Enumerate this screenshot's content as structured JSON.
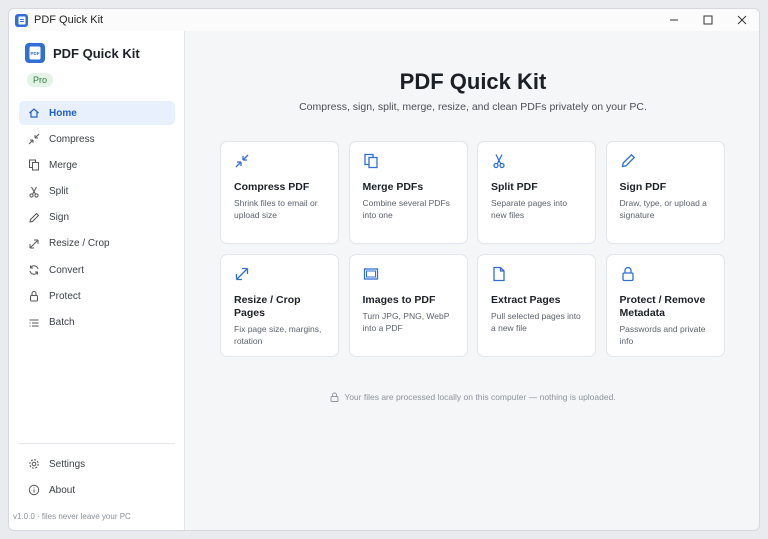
{
  "window": {
    "title": "PDF Quick Kit"
  },
  "sidebar": {
    "brand": "PDF Quick Kit",
    "badge": "Pro",
    "items": [
      {
        "label": "Home",
        "icon": "home-icon",
        "active": true
      },
      {
        "label": "Compress",
        "icon": "compress-icon"
      },
      {
        "label": "Merge",
        "icon": "merge-icon"
      },
      {
        "label": "Split",
        "icon": "scissors-icon"
      },
      {
        "label": "Sign",
        "icon": "pen-icon"
      },
      {
        "label": "Resize / Crop",
        "icon": "resize-icon"
      },
      {
        "label": "Convert",
        "icon": "convert-icon"
      },
      {
        "label": "Protect",
        "icon": "lock-icon"
      },
      {
        "label": "Batch",
        "icon": "list-icon"
      }
    ],
    "bottom_items": [
      {
        "label": "Settings",
        "icon": "gear-icon"
      },
      {
        "label": "About",
        "icon": "info-icon"
      }
    ],
    "version": "v1.0.0 · files never leave your PC"
  },
  "main": {
    "title": "PDF Quick Kit",
    "subtitle": "Compress, sign, split, merge, resize, and clean PDFs privately on your PC.",
    "cards": [
      {
        "title": "Compress PDF",
        "desc": "Shrink files to email or upload size",
        "icon": "compress-icon"
      },
      {
        "title": "Merge PDFs",
        "desc": "Combine several PDFs into one",
        "icon": "merge-icon"
      },
      {
        "title": "Split PDF",
        "desc": "Separate pages into new files",
        "icon": "scissors-icon"
      },
      {
        "title": "Sign PDF",
        "desc": "Draw, type, or upload a signature",
        "icon": "pen-icon"
      },
      {
        "title": "Resize / Crop Pages",
        "desc": "Fix page size, margins, rotation",
        "icon": "resize-icon"
      },
      {
        "title": "Images to PDF",
        "desc": "Turn JPG, PNG, WebP into a PDF",
        "icon": "image-icon"
      },
      {
        "title": "Extract Pages",
        "desc": "Pull selected pages into a new file",
        "icon": "page-icon"
      },
      {
        "title": "Protect / Remove Metadata",
        "desc": "Passwords and private info",
        "icon": "lock-icon"
      }
    ],
    "footer": "Your files are processed locally on this computer — nothing is uploaded."
  },
  "colors": {
    "accent": "#2f6fd6",
    "active_bg": "#e8f0fd",
    "badge_bg": "#e3f3e6"
  }
}
